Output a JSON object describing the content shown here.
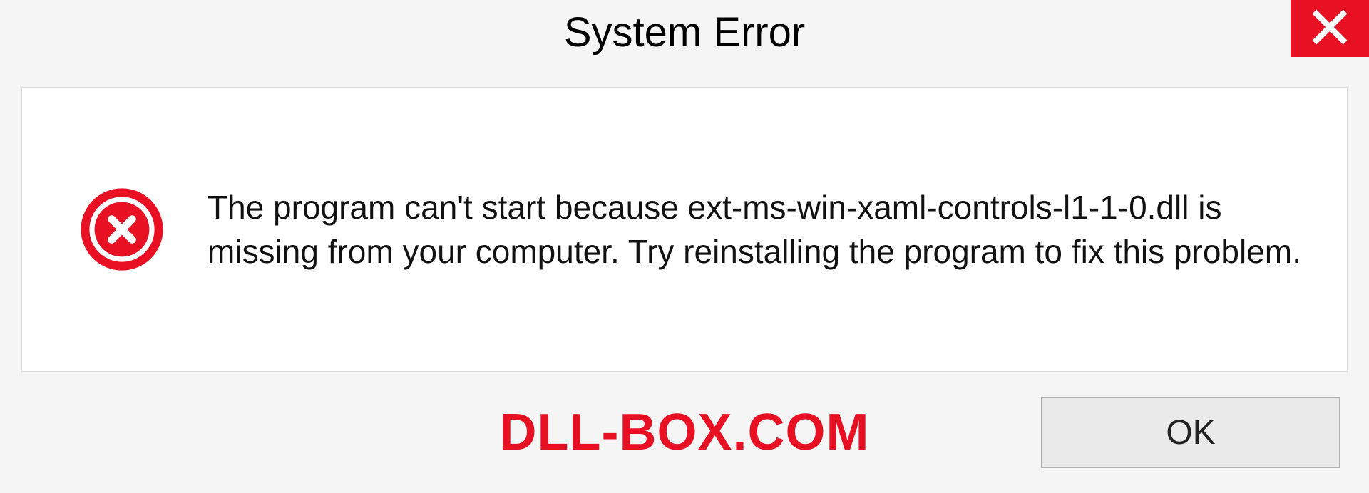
{
  "dialog": {
    "title": "System Error",
    "message": "The program can't start because ext-ms-win-xaml-controls-l1-1-0.dll is missing from your computer. Try reinstalling the program to fix this problem.",
    "ok_label": "OK"
  },
  "watermark": "DLL-BOX.COM",
  "colors": {
    "accent_red": "#e81123"
  }
}
